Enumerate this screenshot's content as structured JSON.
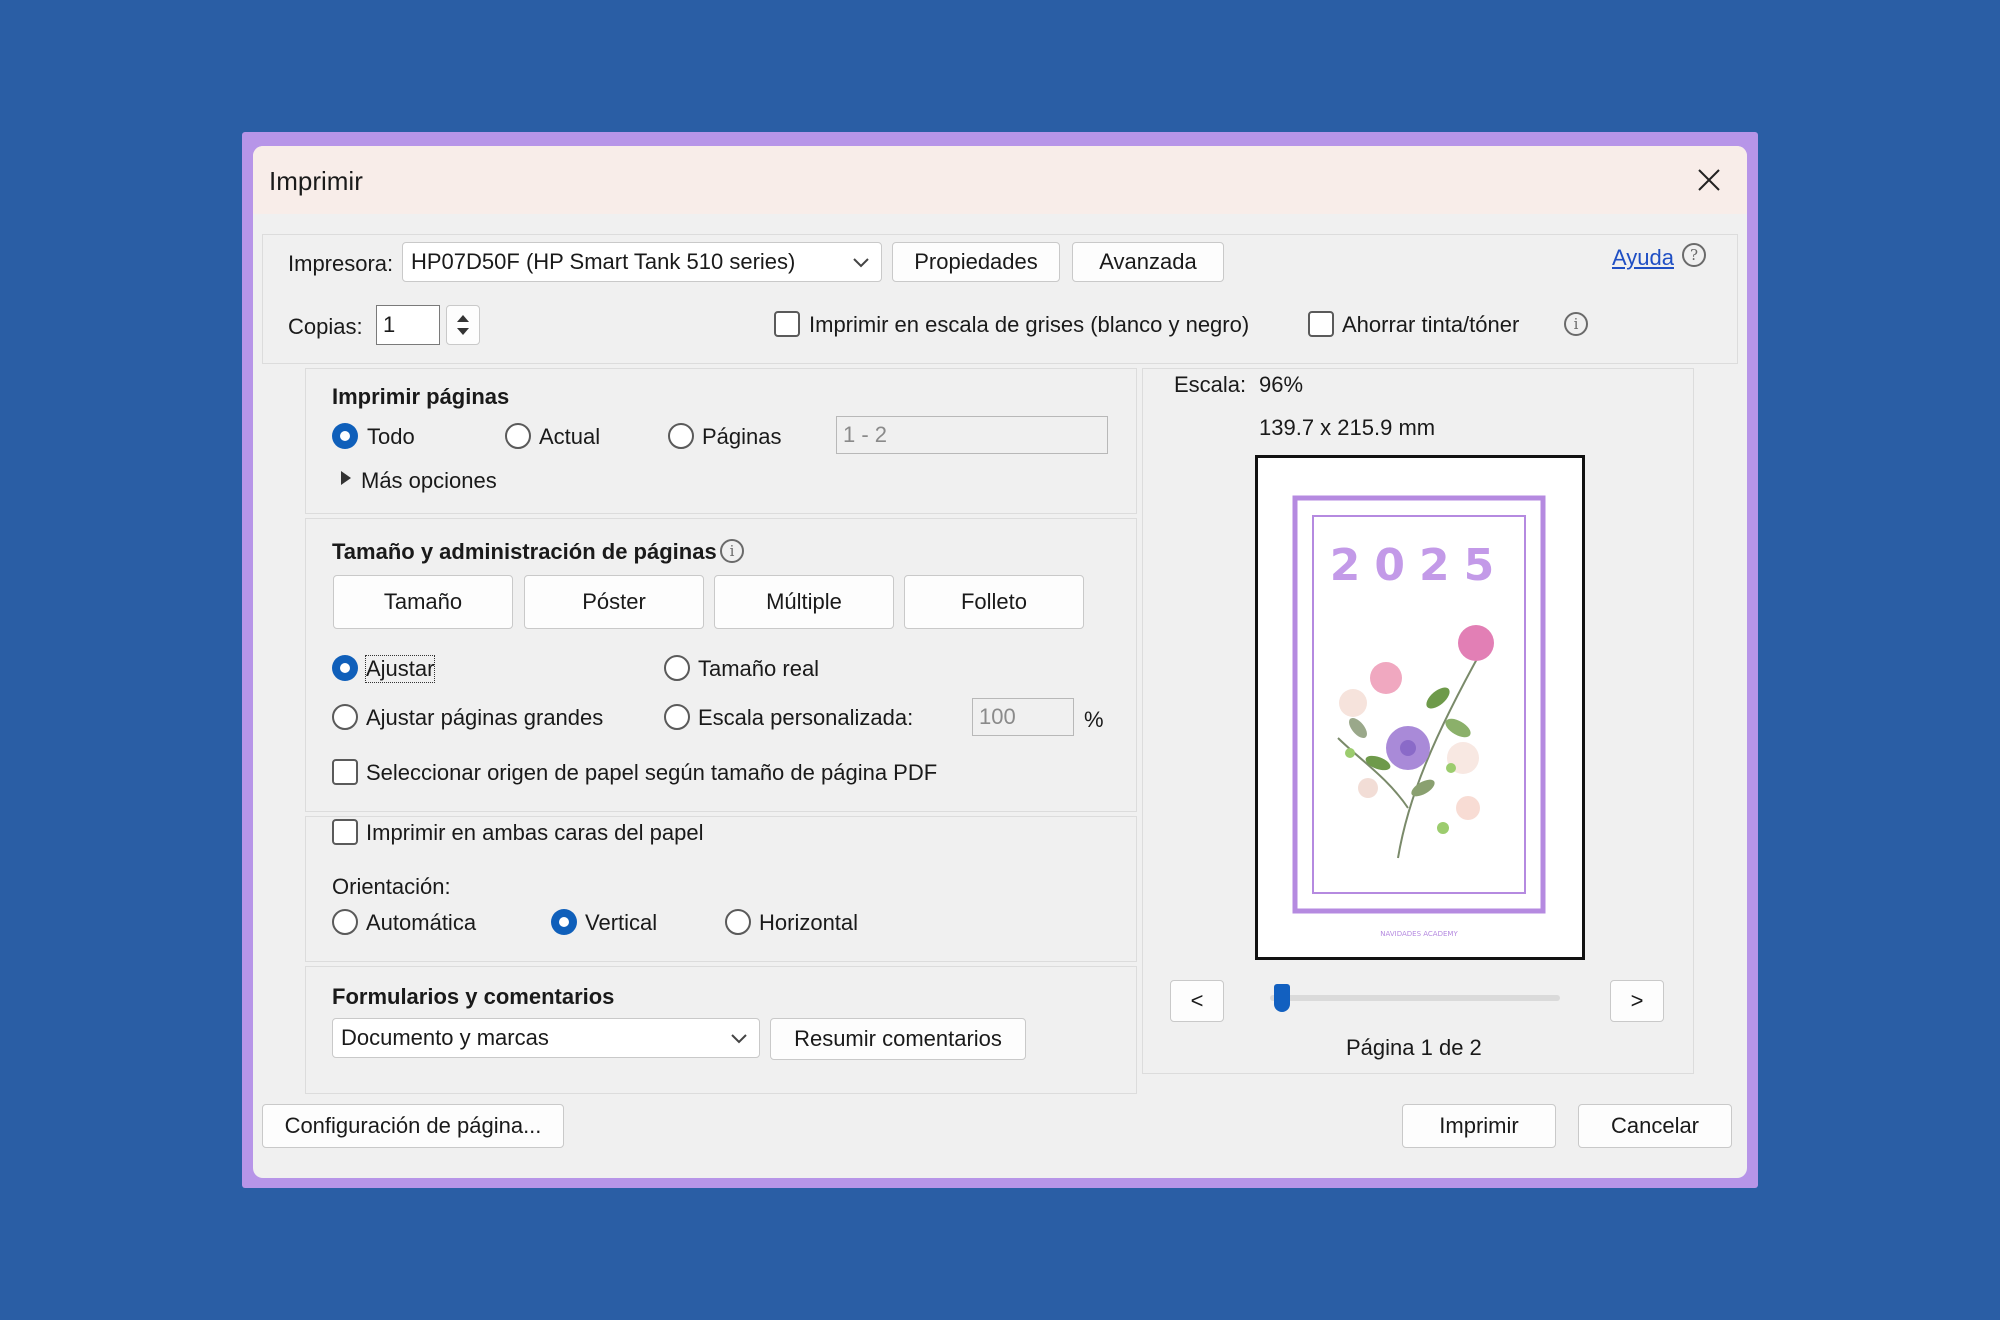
{
  "dialog": {
    "title": "Imprimir"
  },
  "printer": {
    "label": "Impresora:",
    "selected": "HP07D50F (HP Smart Tank 510 series)",
    "properties_button": "Propiedades",
    "advanced_button": "Avanzada",
    "help_link": "Ayuda"
  },
  "copies": {
    "label": "Copias:",
    "value": "1"
  },
  "options": {
    "grayscale_label": "Imprimir en escala de grises (blanco y negro)",
    "grayscale_checked": false,
    "save_ink_label": "Ahorrar tinta/tóner",
    "save_ink_checked": false
  },
  "pages": {
    "heading": "Imprimir páginas",
    "all_label": "Todo",
    "current_label": "Actual",
    "pages_label": "Páginas",
    "pages_value": "1 - 2",
    "selected": "Todo",
    "more_options": "Más opciones"
  },
  "sizing": {
    "heading": "Tamaño y administración de páginas",
    "tabs": [
      "Tamaño",
      "Póster",
      "Múltiple",
      "Folleto"
    ],
    "fit_label": "Ajustar",
    "actual_size_label": "Tamaño real",
    "shrink_label": "Ajustar páginas grandes",
    "custom_scale_label": "Escala personalizada:",
    "custom_scale_value": "100",
    "percent": "%",
    "selected": "Ajustar",
    "paper_source_label": "Seleccionar origen de papel según tamaño de página PDF",
    "paper_source_checked": false
  },
  "duplex": {
    "label": "Imprimir en ambas caras del papel",
    "checked": false
  },
  "orientation": {
    "label": "Orientación:",
    "auto_label": "Automática",
    "portrait_label": "Vertical",
    "landscape_label": "Horizontal",
    "selected": "Vertical"
  },
  "forms": {
    "heading": "Formularios y comentarios",
    "selected": "Documento y marcas",
    "summarize_button": "Resumir comentarios"
  },
  "preview": {
    "scale_label": "Escala:",
    "scale_value": "96%",
    "dimensions": "139.7 x 215.9 mm",
    "page_year": "2025",
    "page_footer": "NAVIDADES ACADEMY",
    "prev_button": "<",
    "next_button": ">",
    "page_status": "Página 1 de 2",
    "slider_position": 0.0
  },
  "footer": {
    "page_setup_button": "Configuración de página...",
    "print_button": "Imprimir",
    "cancel_button": "Cancelar"
  },
  "colors": {
    "accent": "#0f5fba",
    "frame": "#b795e8",
    "background": "#2a5ea5",
    "page_lilac": "#b58ae0"
  }
}
